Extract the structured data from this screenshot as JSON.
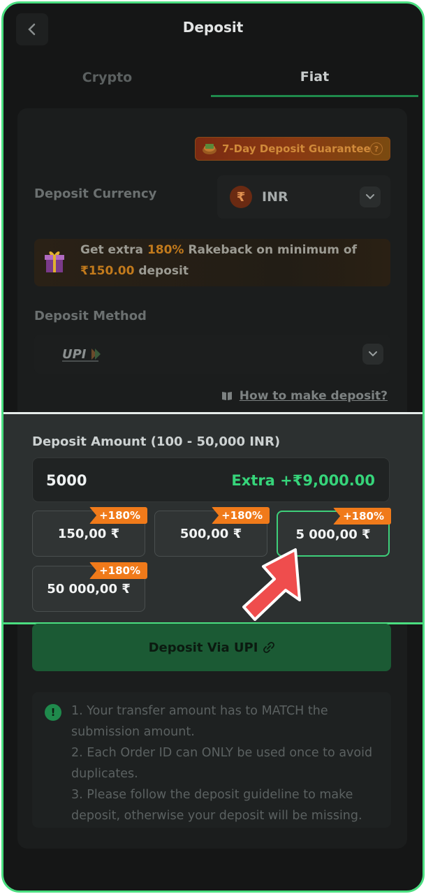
{
  "header": {
    "title": "Deposit"
  },
  "tabs": [
    {
      "label": "Crypto"
    },
    {
      "label": "Fiat"
    }
  ],
  "guarantee": {
    "label": "7-Day Deposit Guarantee"
  },
  "currency": {
    "label": "Deposit Currency",
    "symbol": "₹",
    "code": "INR"
  },
  "promo": {
    "part1": "Get extra ",
    "percent": "180%",
    "part2": " Rakeback on minimum of",
    "min_amount": "₹150.00",
    "part3": " deposit"
  },
  "method": {
    "label": "Deposit Method",
    "logo_text": "UPI"
  },
  "howto": {
    "label": "How to make deposit?"
  },
  "amount": {
    "label": "Deposit Amount (100 - 50,000 INR)",
    "value": "5000",
    "extra": "Extra +₹9,000.00",
    "presets": [
      {
        "value": "150,00 ₹",
        "bonus": "+180%"
      },
      {
        "value": "500,00 ₹",
        "bonus": "+180%"
      },
      {
        "value": "5 000,00 ₹",
        "bonus": "+180%",
        "selected": true
      },
      {
        "value": "50 000,00 ₹",
        "bonus": "+180%"
      }
    ]
  },
  "submit": {
    "label": "Deposit Via UPI"
  },
  "notice": {
    "items": [
      "1. Your transfer amount has to MATCH the submission amount.",
      "2. Each Order ID can ONLY be used once to avoid duplicates.",
      "3. Please follow the deposit guideline to make deposit, otherwise your deposit will be missing."
    ]
  },
  "colors": {
    "accent": "#4ade80",
    "bonus": "#f07a1a",
    "extra": "#36d47a",
    "arrow": "#ef4d4d"
  }
}
